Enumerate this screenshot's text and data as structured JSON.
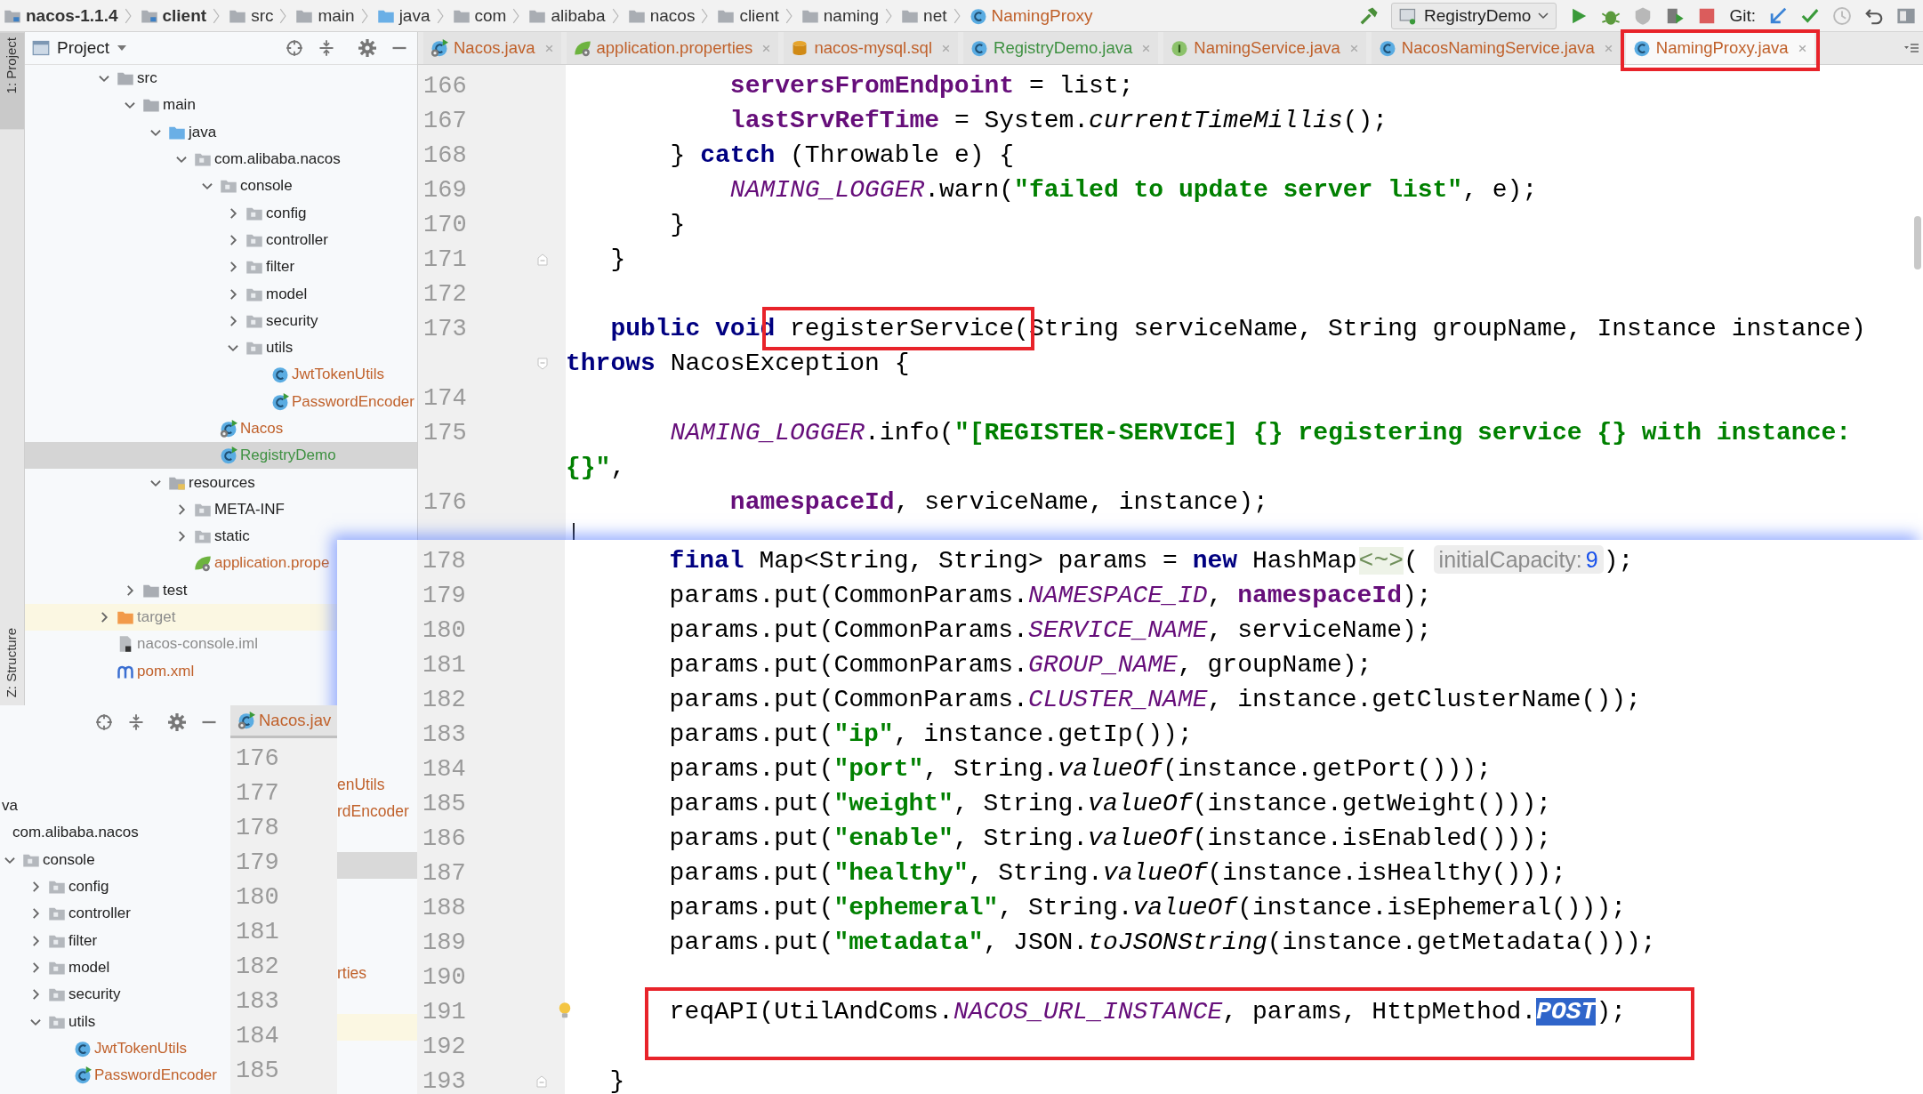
{
  "breadcrumb": [
    {
      "label": "nacos-1.1.4",
      "kind": "module"
    },
    {
      "label": "client",
      "kind": "module"
    },
    {
      "label": "src",
      "kind": "folder"
    },
    {
      "label": "main",
      "kind": "folder"
    },
    {
      "label": "java",
      "kind": "source-folder"
    },
    {
      "label": "com",
      "kind": "folder"
    },
    {
      "label": "alibaba",
      "kind": "folder"
    },
    {
      "label": "nacos",
      "kind": "folder"
    },
    {
      "label": "client",
      "kind": "folder"
    },
    {
      "label": "naming",
      "kind": "folder"
    },
    {
      "label": "net",
      "kind": "folder"
    },
    {
      "label": "NamingProxy",
      "kind": "class"
    }
  ],
  "toolbar": {
    "run_config": "RegistryDemo",
    "vcs_label": "Git:"
  },
  "tool_strip": {
    "top": "1: Project",
    "bottom": "Z: Structure"
  },
  "project_panel": {
    "title": "Project"
  },
  "project_tree": [
    {
      "label": "src",
      "kind": "folder",
      "expanded": true,
      "selected": false,
      "children": [
        {
          "label": "main",
          "kind": "folder",
          "expanded": true,
          "selected": false,
          "children": [
            {
              "label": "java",
              "kind": "source-folder",
              "expanded": true,
              "selected": false,
              "children": [
                {
                  "label": "com.alibaba.nacos",
                  "kind": "package",
                  "expanded": true,
                  "selected": false,
                  "children": [
                    {
                      "label": "console",
                      "kind": "package",
                      "expanded": true,
                      "selected": false,
                      "children": [
                        {
                          "label": "config",
                          "kind": "package",
                          "expanded": false,
                          "selected": false
                        },
                        {
                          "label": "controller",
                          "kind": "package",
                          "expanded": false,
                          "selected": false
                        },
                        {
                          "label": "filter",
                          "kind": "package",
                          "expanded": false,
                          "selected": false
                        },
                        {
                          "label": "model",
                          "kind": "package",
                          "expanded": false,
                          "selected": false
                        },
                        {
                          "label": "security",
                          "kind": "package",
                          "expanded": false,
                          "selected": false
                        },
                        {
                          "label": "utils",
                          "kind": "package",
                          "expanded": true,
                          "selected": false,
                          "children": [
                            {
                              "label": "JwtTokenUtils",
                              "kind": "class",
                              "color": "#c0612b",
                              "selected": false
                            },
                            {
                              "label": "PasswordEncoder",
                              "kind": "run-class",
                              "color": "#c0612b",
                              "selected": false
                            }
                          ]
                        }
                      ]
                    },
                    {
                      "label": "Nacos",
                      "kind": "boot-class",
                      "color": "#c0612b",
                      "selected": false
                    },
                    {
                      "label": "RegistryDemo",
                      "kind": "run-class",
                      "color": "#3f9142",
                      "selected": true
                    }
                  ]
                }
              ]
            },
            {
              "label": "resources",
              "kind": "resources-folder",
              "expanded": true,
              "selected": false,
              "children": [
                {
                  "label": "META-INF",
                  "kind": "package",
                  "expanded": false,
                  "selected": false
                },
                {
                  "label": "static",
                  "kind": "package",
                  "expanded": false,
                  "selected": false
                },
                {
                  "label": "application.prope",
                  "kind": "properties",
                  "color": "#c0612b",
                  "selected": false
                }
              ]
            }
          ]
        },
        {
          "label": "test",
          "kind": "folder",
          "expanded": false,
          "selected": false
        }
      ]
    },
    {
      "label": "target",
      "kind": "excluded-folder",
      "expanded": false,
      "color": "#8c8c8c",
      "selected": false
    },
    {
      "label": "nacos-console.iml",
      "kind": "module-file",
      "color": "#8c8c8c",
      "selected": false
    },
    {
      "label": "pom.xml",
      "kind": "pom",
      "color": "#c0612b",
      "selected": false
    }
  ],
  "tabs": [
    {
      "label": "Nacos.java",
      "kind": "boot-class",
      "color": "#c0612b",
      "selected": false,
      "annotated": false
    },
    {
      "label": "application.properties",
      "kind": "properties",
      "color": "#c0612b",
      "selected": false,
      "annotated": false
    },
    {
      "label": "nacos-mysql.sql",
      "kind": "sql",
      "color": "#c0612b",
      "selected": false,
      "annotated": false
    },
    {
      "label": "RegistryDemo.java",
      "kind": "class",
      "color": "#3f9142",
      "selected": false,
      "annotated": false
    },
    {
      "label": "NamingService.java",
      "kind": "interface",
      "color": "#c0612b",
      "selected": false,
      "annotated": false
    },
    {
      "label": "NacosNamingService.java",
      "kind": "class",
      "color": "#c0612b",
      "selected": false,
      "annotated": false
    },
    {
      "label": "NamingProxy.java",
      "kind": "class",
      "color": "#c0612b",
      "selected": true,
      "annotated": true
    }
  ],
  "main_editor": {
    "rows": [
      {
        "number": "166",
        "tokens": [
          {
            "kind": "field",
            "text": "           serversFromEndpoint"
          },
          {
            "kind": "plain",
            "text": " = list;"
          }
        ]
      },
      {
        "number": "167",
        "tokens": [
          {
            "kind": "field",
            "text": "           lastSrvRefTime"
          },
          {
            "kind": "plain",
            "text": " = System."
          },
          {
            "kind": "static-method",
            "text": "currentTimeMillis"
          },
          {
            "kind": "plain",
            "text": "();"
          }
        ]
      },
      {
        "number": "168",
        "tokens": [
          {
            "kind": "plain",
            "text": "       } "
          },
          {
            "kind": "keyword",
            "text": "catch"
          },
          {
            "kind": "plain",
            "text": " (Throwable e) {"
          }
        ]
      },
      {
        "number": "169",
        "tokens": [
          {
            "kind": "constant",
            "text": "           NAMING_LOGGER"
          },
          {
            "kind": "plain",
            "text": ".warn("
          },
          {
            "kind": "string",
            "text": "\"failed to update server list\""
          },
          {
            "kind": "plain",
            "text": ", e);"
          }
        ]
      },
      {
        "number": "170",
        "tokens": [
          {
            "kind": "plain",
            "text": "       }"
          }
        ]
      },
      {
        "number": "171",
        "fold_end": true,
        "tokens": [
          {
            "kind": "plain",
            "text": "   }"
          }
        ]
      },
      {
        "number": "172"
      },
      {
        "number": "173",
        "tokens": [
          {
            "kind": "keyword",
            "text": "   public void"
          },
          {
            "kind": "plain",
            "text": " registerService(",
            "boxed": true
          },
          {
            "kind": "plain",
            "text": "String serviceName, String groupName, Instance instance)"
          }
        ]
      },
      {
        "fold_start": true,
        "tokens": [
          {
            "kind": "keyword",
            "text": "throws"
          },
          {
            "kind": "plain",
            "text": " NacosException {"
          }
        ]
      },
      {
        "number": "174"
      },
      {
        "number": "175",
        "tokens": [
          {
            "kind": "constant",
            "text": "       NAMING_LOGGER"
          },
          {
            "kind": "plain",
            "text": ".info("
          },
          {
            "kind": "string",
            "text": "\"[REGISTER-SERVICE] {} registering service {} with instance:"
          }
        ]
      },
      {
        "tokens": [
          {
            "kind": "string",
            "text": "{}\""
          },
          {
            "kind": "plain",
            "text": ","
          }
        ]
      },
      {
        "number": "176",
        "tokens": [
          {
            "kind": "field",
            "text": "           namespaceId"
          },
          {
            "kind": "plain",
            "text": ", serviceName, instance);"
          }
        ]
      },
      {
        "caret": true
      }
    ]
  },
  "overlay_editor": {
    "side_rows": [
      {
        "kind": "plain",
        "text": "enUtils",
        "color": "#c0612b",
        "selected": false
      },
      {
        "kind": "plain",
        "text": "rdEncoder",
        "color": "#c0612b",
        "selected": false
      },
      {
        "kind": "plain",
        "selected": false
      },
      {
        "kind": "plain",
        "selected": true
      },
      {
        "kind": "plain",
        "selected": false
      },
      {
        "kind": "plain",
        "selected": false
      },
      {
        "kind": "plain",
        "selected": false
      },
      {
        "kind": "plain",
        "text": "rties",
        "color": "#c0612b",
        "selected": false
      },
      {
        "kind": "plain",
        "selected": false
      },
      {
        "kind": "excluded",
        "selected": false
      }
    ],
    "rows": [
      {
        "number": "178",
        "tokens": [
          {
            "kind": "keyword",
            "text": "       final"
          },
          {
            "kind": "plain",
            "text": " Map<String, String> params = "
          },
          {
            "kind": "keyword",
            "text": "new"
          },
          {
            "kind": "plain",
            "text": " HashMap"
          },
          {
            "kind": "folded",
            "text": "<~>"
          },
          {
            "kind": "plain",
            "text": "( "
          },
          {
            "kind": "hint",
            "text": "initialCapacity:"
          },
          {
            "kind": "hint-number",
            "text": "9"
          },
          {
            "kind": "plain",
            "text": ");"
          }
        ]
      },
      {
        "number": "179",
        "tokens": [
          {
            "kind": "plain",
            "text": "       params.put(CommonParams."
          },
          {
            "kind": "constant",
            "text": "NAMESPACE_ID"
          },
          {
            "kind": "plain",
            "text": ", "
          },
          {
            "kind": "field",
            "text": "namespaceId"
          },
          {
            "kind": "plain",
            "text": ");"
          }
        ]
      },
      {
        "number": "180",
        "tokens": [
          {
            "kind": "plain",
            "text": "       params.put(CommonParams."
          },
          {
            "kind": "constant",
            "text": "SERVICE_NAME"
          },
          {
            "kind": "plain",
            "text": ", serviceName);"
          }
        ]
      },
      {
        "number": "181",
        "tokens": [
          {
            "kind": "plain",
            "text": "       params.put(CommonParams."
          },
          {
            "kind": "constant",
            "text": "GROUP_NAME"
          },
          {
            "kind": "plain",
            "text": ", groupName);"
          }
        ]
      },
      {
        "number": "182",
        "tokens": [
          {
            "kind": "plain",
            "text": "       params.put(CommonParams."
          },
          {
            "kind": "constant",
            "text": "CLUSTER_NAME"
          },
          {
            "kind": "plain",
            "text": ", instance.getClusterName());"
          }
        ]
      },
      {
        "number": "183",
        "tokens": [
          {
            "kind": "plain",
            "text": "       params.put("
          },
          {
            "kind": "string",
            "text": "\"ip\""
          },
          {
            "kind": "plain",
            "text": ", instance.getIp());"
          }
        ]
      },
      {
        "number": "184",
        "tokens": [
          {
            "kind": "plain",
            "text": "       params.put("
          },
          {
            "kind": "string",
            "text": "\"port\""
          },
          {
            "kind": "plain",
            "text": ", String."
          },
          {
            "kind": "static-method",
            "text": "valueOf"
          },
          {
            "kind": "plain",
            "text": "(instance.getPort()));"
          }
        ]
      },
      {
        "number": "185",
        "tokens": [
          {
            "kind": "plain",
            "text": "       params.put("
          },
          {
            "kind": "string",
            "text": "\"weight\""
          },
          {
            "kind": "plain",
            "text": ", String."
          },
          {
            "kind": "static-method",
            "text": "valueOf"
          },
          {
            "kind": "plain",
            "text": "(instance.getWeight()));"
          }
        ]
      },
      {
        "number": "186",
        "tokens": [
          {
            "kind": "plain",
            "text": "       params.put("
          },
          {
            "kind": "string",
            "text": "\"enable\""
          },
          {
            "kind": "plain",
            "text": ", String."
          },
          {
            "kind": "static-method",
            "text": "valueOf"
          },
          {
            "kind": "plain",
            "text": "(instance.isEnabled()));"
          }
        ]
      },
      {
        "number": "187",
        "tokens": [
          {
            "kind": "plain",
            "text": "       params.put("
          },
          {
            "kind": "string",
            "text": "\"healthy\""
          },
          {
            "kind": "plain",
            "text": ", String."
          },
          {
            "kind": "static-method",
            "text": "valueOf"
          },
          {
            "kind": "plain",
            "text": "(instance.isHealthy()));"
          }
        ]
      },
      {
        "number": "188",
        "tokens": [
          {
            "kind": "plain",
            "text": "       params.put("
          },
          {
            "kind": "string",
            "text": "\"ephemeral\""
          },
          {
            "kind": "plain",
            "text": ", String."
          },
          {
            "kind": "static-method",
            "text": "valueOf"
          },
          {
            "kind": "plain",
            "text": "(instance.isEphemeral()));"
          }
        ]
      },
      {
        "number": "189",
        "tokens": [
          {
            "kind": "plain",
            "text": "       params.put("
          },
          {
            "kind": "string",
            "text": "\"metadata\""
          },
          {
            "kind": "plain",
            "text": ", JSON."
          },
          {
            "kind": "static-method",
            "text": "toJSONString"
          },
          {
            "kind": "plain",
            "text": "(instance.getMetadata()));"
          }
        ]
      },
      {
        "number": "190"
      },
      {
        "number": "191",
        "boxed": true,
        "bulb": true,
        "tokens": [
          {
            "kind": "plain",
            "text": "       reqAPI(UtilAndComs."
          },
          {
            "kind": "constant",
            "text": "NACOS_URL_INSTANCE"
          },
          {
            "kind": "plain",
            "text": ", params, HttpMethod."
          },
          {
            "kind": "selected-constant",
            "text": "POST"
          },
          {
            "kind": "plain",
            "text": ");"
          }
        ]
      },
      {
        "number": "192",
        "boxed": true
      },
      {
        "number": "193",
        "fold_end": true,
        "tokens": [
          {
            "kind": "plain",
            "text": "   }"
          }
        ]
      }
    ]
  },
  "overlay_panel": {
    "tab": {
      "label": "Nacos.jav",
      "kind": "boot-class",
      "color": "#c0612b"
    },
    "tree": [
      {
        "label": "va",
        "kind": "cut",
        "selected": false,
        "children": [
          {
            "label": "com.alibaba.nacos",
            "kind": "cut",
            "selected": false,
            "children": [
              {
                "label": "console",
                "kind": "package",
                "expanded": true,
                "selected": false,
                "children": [
                  {
                    "label": "config",
                    "kind": "package",
                    "expanded": false,
                    "selected": false
                  },
                  {
                    "label": "controller",
                    "kind": "package",
                    "expanded": false,
                    "selected": false
                  },
                  {
                    "label": "filter",
                    "kind": "package",
                    "expanded": false,
                    "selected": false
                  },
                  {
                    "label": "model",
                    "kind": "package",
                    "expanded": false,
                    "selected": false
                  },
                  {
                    "label": "security",
                    "kind": "package",
                    "expanded": false,
                    "selected": false
                  },
                  {
                    "label": "utils",
                    "kind": "package",
                    "expanded": true,
                    "selected": false,
                    "children": [
                      {
                        "label": "JwtTokenUtils",
                        "kind": "class",
                        "color": "#c0612b",
                        "selected": false
                      },
                      {
                        "label": "PasswordEncoder",
                        "kind": "run-class",
                        "color": "#c0612b",
                        "selected": false
                      }
                    ]
                  }
                ]
              }
            ]
          }
        ]
      }
    ],
    "line_numbers": [
      "176",
      "177",
      "178",
      "179",
      "180",
      "181",
      "182",
      "183",
      "184",
      "185"
    ]
  }
}
